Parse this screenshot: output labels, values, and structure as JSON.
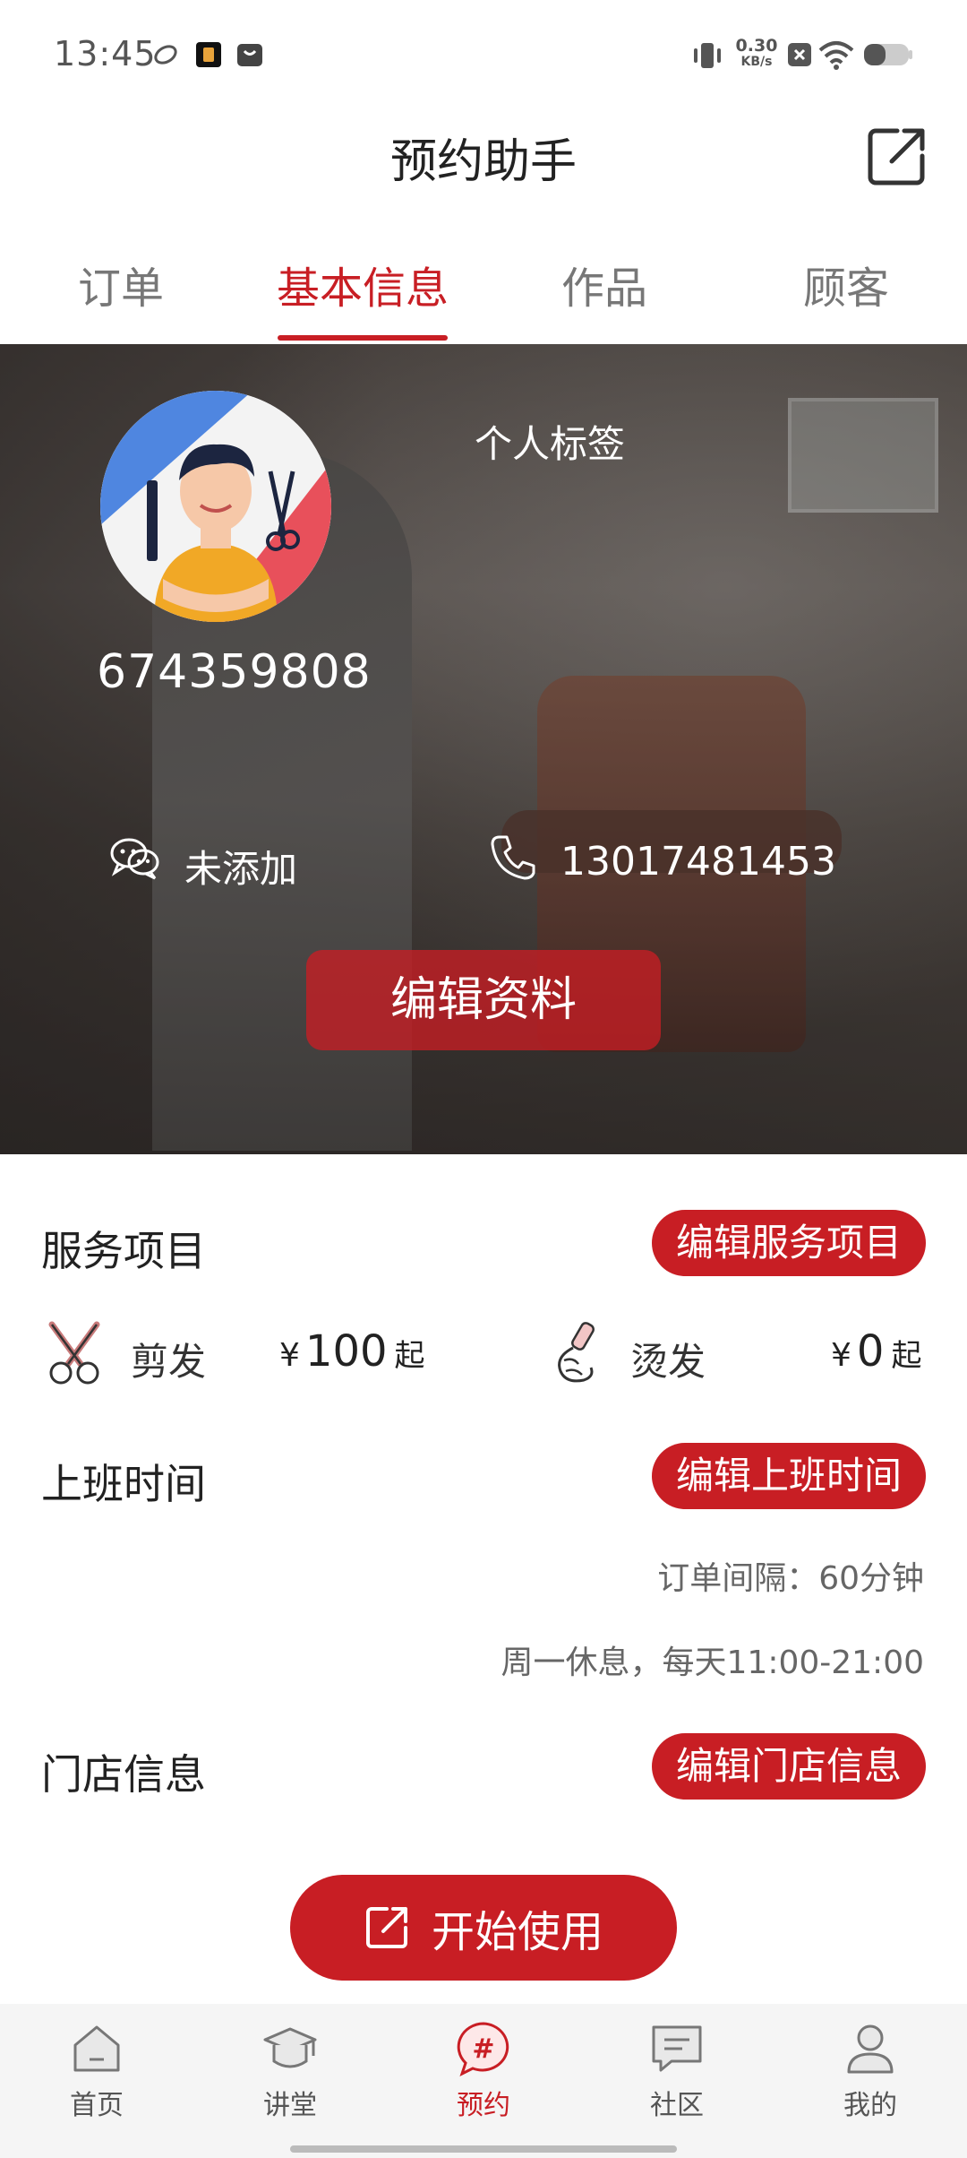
{
  "status_bar": {
    "time": "13:45",
    "net_speed_top": "0.30",
    "net_speed_bottom": "KB/s",
    "icons": [
      "cloud-icon",
      "app-icon",
      "bag-icon",
      "vibrate-icon",
      "close-notif-icon",
      "wifi-icon",
      "battery-icon"
    ]
  },
  "header": {
    "title": "预约助手",
    "share_icon": "external-link-icon"
  },
  "tabs": [
    {
      "label": "订单",
      "active": false
    },
    {
      "label": "基本信息",
      "active": true
    },
    {
      "label": "作品",
      "active": false
    },
    {
      "label": "顾客",
      "active": false
    }
  ],
  "profile": {
    "personal_tag": "个人标签",
    "user_id": "674359808",
    "wechat_label": "未添加",
    "phone": "13017481453",
    "edit_button": "编辑资料"
  },
  "services": {
    "title": "服务项目",
    "edit_button": "编辑服务项目",
    "items": [
      {
        "name": "剪发",
        "currency": "¥",
        "price": "100",
        "unit": "起",
        "icon": "scissors-icon"
      },
      {
        "name": "烫发",
        "currency": "¥",
        "price": "0",
        "unit": "起",
        "icon": "curling-iron-icon"
      }
    ]
  },
  "work_hours": {
    "title": "上班时间",
    "edit_button": "编辑上班时间",
    "order_interval": "订单间隔：60分钟",
    "schedule": "周一休息，每天11:00-21:00"
  },
  "store_info": {
    "title": "门店信息",
    "edit_button": "编辑门店信息"
  },
  "start_button": "开始使用",
  "bottom_nav": [
    {
      "label": "首页",
      "icon": "home-icon",
      "active": false
    },
    {
      "label": "讲堂",
      "icon": "graduation-cap-icon",
      "active": false
    },
    {
      "label": "预约",
      "icon": "hashtag-bubble-icon",
      "active": true
    },
    {
      "label": "社区",
      "icon": "chat-icon",
      "active": false
    },
    {
      "label": "我的",
      "icon": "user-icon",
      "active": false
    }
  ],
  "colors": {
    "accent": "#c81e24",
    "text_primary": "#222222",
    "text_secondary": "#666666"
  }
}
